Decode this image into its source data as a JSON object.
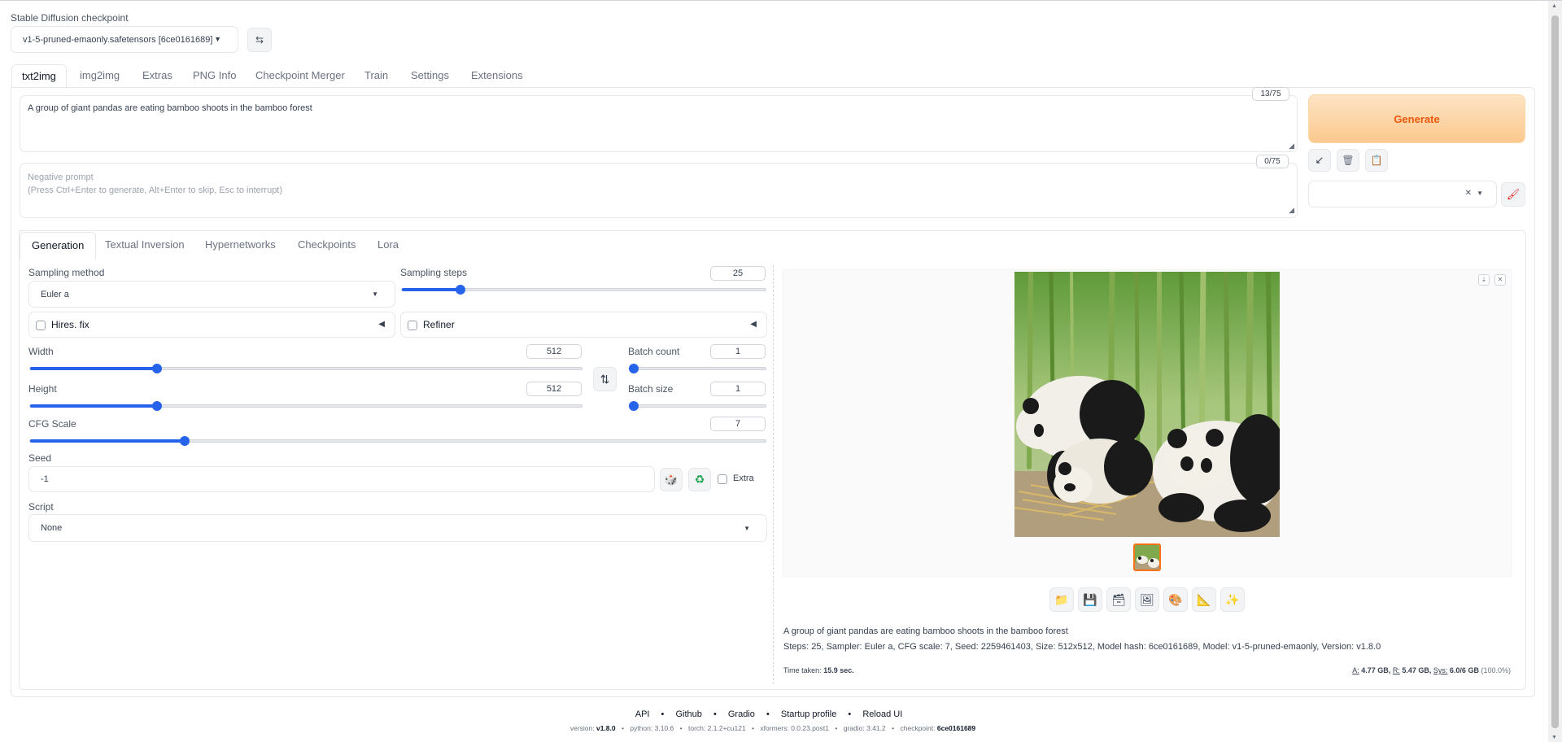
{
  "checkpoint": {
    "label": "Stable Diffusion checkpoint",
    "value": "v1-5-pruned-emaonly.safetensors [6ce0161689]"
  },
  "main_tabs": [
    "txt2img",
    "img2img",
    "Extras",
    "PNG Info",
    "Checkpoint Merger",
    "Train",
    "Settings",
    "Extensions"
  ],
  "prompt": {
    "text": "A group of giant pandas are eating bamboo shoots in the bamboo forest",
    "counter": "13/75"
  },
  "negative_prompt": {
    "placeholder_line1": "Negative prompt",
    "placeholder_line2": "(Press Ctrl+Enter to generate, Alt+Enter to skip, Esc to interrupt)",
    "counter": "0/75"
  },
  "generate_label": "Generate",
  "sub_tabs": [
    "Generation",
    "Textual Inversion",
    "Hypernetworks",
    "Checkpoints",
    "Lora"
  ],
  "sampling": {
    "method_label": "Sampling method",
    "method_value": "Euler a",
    "steps_label": "Sampling steps",
    "steps_value": "25",
    "steps_fraction": 0.16
  },
  "hires_label": "Hires. fix",
  "refiner_label": "Refiner",
  "width": {
    "label": "Width",
    "value": "512",
    "fraction": 0.23
  },
  "height": {
    "label": "Height",
    "value": "512",
    "fraction": 0.23
  },
  "batch_count": {
    "label": "Batch count",
    "value": "1",
    "fraction": 0.0
  },
  "batch_size": {
    "label": "Batch size",
    "value": "1",
    "fraction": 0.0
  },
  "cfg": {
    "label": "CFG Scale",
    "value": "7",
    "fraction": 0.21
  },
  "seed": {
    "label": "Seed",
    "value": "-1",
    "extra_label": "Extra"
  },
  "script": {
    "label": "Script",
    "value": "None"
  },
  "output": {
    "prompt_text": "A group of giant pandas are eating bamboo shoots in the bamboo forest",
    "params": "Steps: 25, Sampler: Euler a, CFG scale: 7, Seed: 2259461403, Size: 512x512, Model hash: 6ce0161689, Model: v1-5-pruned-emaonly, Version: v1.8.0",
    "time_label": "Time taken:",
    "time_value": "15.9 sec.",
    "mem_a_label": "A:",
    "mem_a": "4.77 GB,",
    "mem_r_label": "R:",
    "mem_r": "5.47 GB,",
    "mem_sys_label": "Sys:",
    "mem_sys": "6.0/6 GB",
    "mem_pct": "(100.0%)"
  },
  "footer": {
    "links": [
      "API",
      "Github",
      "Gradio",
      "Startup profile",
      "Reload UI"
    ],
    "version_label": "version:",
    "version": "v1.8.0",
    "python_label": "python:",
    "python": "3.10.6",
    "torch_label": "torch:",
    "torch": "2.1.2+cu121",
    "xformers_label": "xformers:",
    "xformers": "0.0.23.post1",
    "gradio_label": "gradio:",
    "gradio": "3.41.2",
    "checkpoint_label": "checkpoint:",
    "checkpoint": "6ce0161689"
  }
}
